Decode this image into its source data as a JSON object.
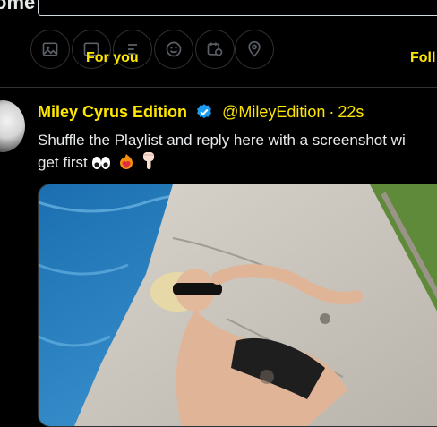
{
  "header": {
    "title": "ome"
  },
  "toolbar": {
    "icons": [
      "image-icon",
      "gif-icon",
      "poll-icon",
      "emoji-icon",
      "schedule-icon",
      "location-icon"
    ]
  },
  "tabs": [
    {
      "label": "For you"
    },
    {
      "label": "Foll"
    }
  ],
  "tweet": {
    "display_name": "Miley Cyrus Edition",
    "handle": "@MileyEdition",
    "separator": "·",
    "time": "22s",
    "text_line1": "Shuffle the Playlist and reply here with a screenshot wi",
    "text_line2": "get first",
    "emojis": [
      "eyes-emoji",
      "heart-on-fire-emoji",
      "pointing-down-emoji"
    ]
  },
  "colors": {
    "accent": "#ffe600",
    "verified": "#1d9bf0",
    "background": "#000000"
  }
}
